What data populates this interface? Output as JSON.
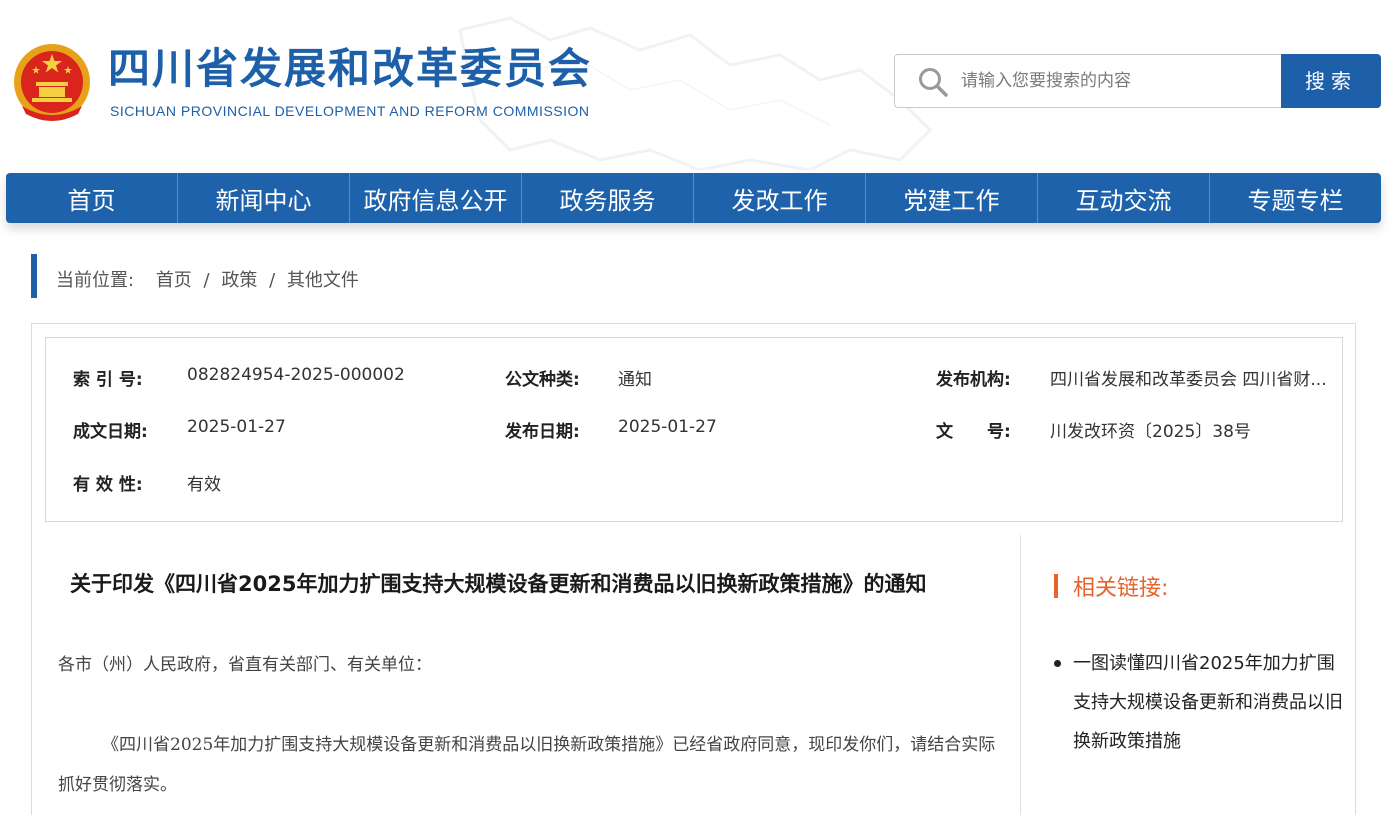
{
  "header": {
    "title": "四川省发展和改革委员会",
    "subtitle": "SICHUAN PROVINCIAL DEVELOPMENT AND REFORM COMMISSION",
    "emblem_icon": "national-emblem-icon"
  },
  "search": {
    "placeholder": "请输入您要搜索的内容",
    "button_label": "搜索"
  },
  "nav": {
    "items": [
      "首页",
      "新闻中心",
      "政府信息公开",
      "政务服务",
      "发改工作",
      "党建工作",
      "互动交流",
      "专题专栏"
    ]
  },
  "breadcrumb": {
    "label": "当前位置:",
    "items": [
      "首页",
      "政策",
      "其他文件"
    ],
    "separator": "/"
  },
  "meta": {
    "index_label": "索 引 号:",
    "index_value": "082824954-2025-000002",
    "type_label": "公文种类:",
    "type_value": "通知",
    "publisher_label": "发布机构:",
    "publisher_value": "四川省发展和改革委员会 四川省财...",
    "created_label": "成文日期:",
    "created_value": "2025-01-27",
    "published_label": "发布日期:",
    "published_value": "2025-01-27",
    "docno_label": "文　　号:",
    "docno_value": "川发改环资〔2025〕38号",
    "validity_label": "有 效 性:",
    "validity_value": "有效"
  },
  "article": {
    "title": "关于印发《四川省2025年加力扩围支持大规模设备更新和消费品以旧换新政策措施》的通知",
    "greeting": "各市（州）人民政府，省直有关部门、有关单位：",
    "body": "《四川省2025年加力扩围支持大规模设备更新和消费品以旧换新政策措施》已经省政府同意，现印发你们，请结合实际抓好贯彻落实。"
  },
  "related": {
    "title": "相关链接:",
    "items": [
      "一图读懂四川省2025年加力扩围支持大规模设备更新和消费品以旧换新政策措施"
    ]
  },
  "colors": {
    "brand_blue": "#1d5fa8",
    "accent_orange": "#e8622b"
  }
}
